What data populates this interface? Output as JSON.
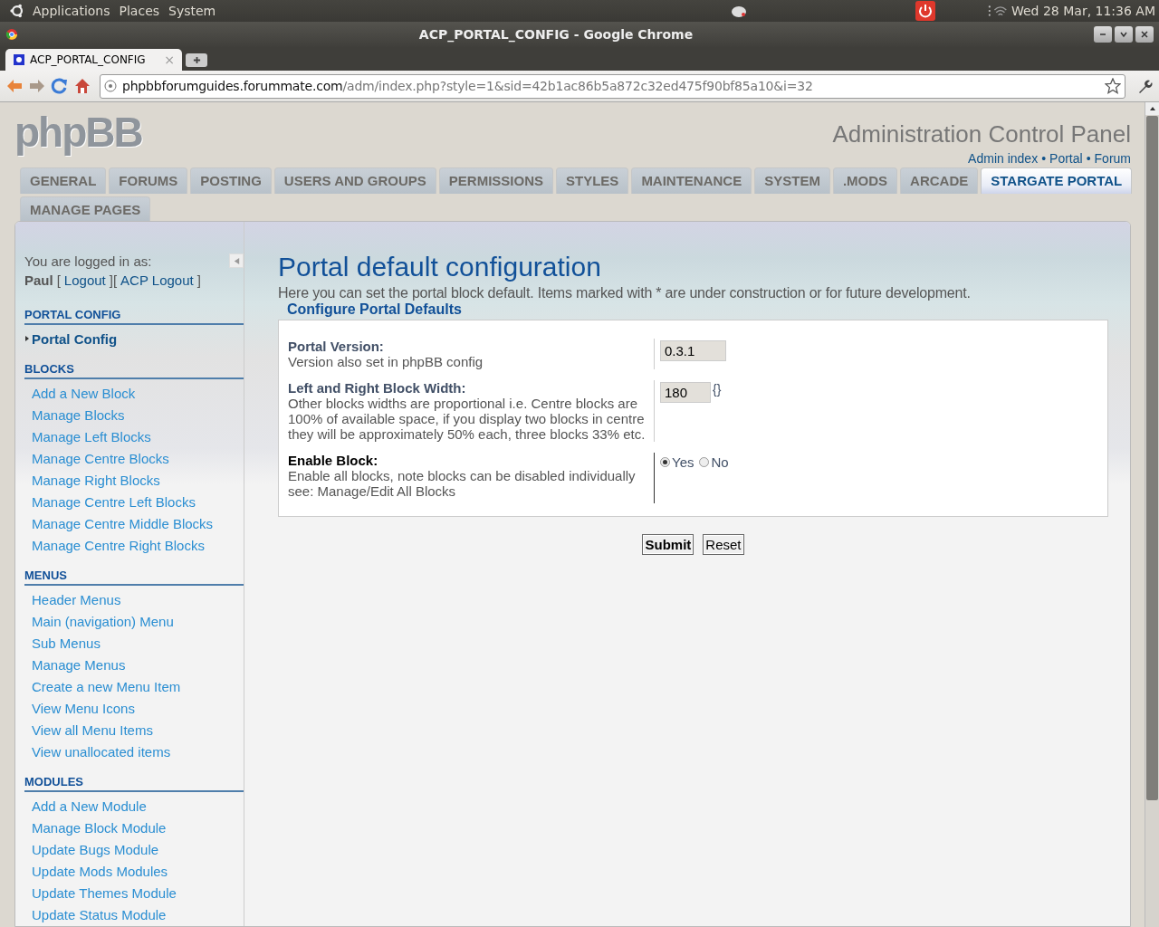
{
  "system_bar": {
    "menus": [
      "Applications",
      "Places",
      "System"
    ],
    "clock": "Wed 28 Mar, 11:36 AM"
  },
  "window": {
    "title": "ACP_PORTAL_CONFIG - Google Chrome"
  },
  "browser_tabs": [
    {
      "label": "ACP_PORTAL_CONFIG",
      "close": "×",
      "selected": true
    }
  ],
  "address_bar": {
    "host": "phpbbforumguides.forummate.com",
    "path": "/adm/index.php?style=1&sid=42b1ac86b5a872c32ed475f90bf85a10&i=32"
  },
  "header": {
    "logo": "phpBB",
    "title": "Administration Control Panel",
    "links": [
      "Admin index",
      "Portal",
      "Forum"
    ],
    "link_separator": "•"
  },
  "nav_tabs": [
    {
      "label": "GENERAL",
      "selected": false
    },
    {
      "label": "FORUMS",
      "selected": false
    },
    {
      "label": "POSTING",
      "selected": false
    },
    {
      "label": "USERS AND GROUPS",
      "selected": false
    },
    {
      "label": "PERMISSIONS",
      "selected": false
    },
    {
      "label": "STYLES",
      "selected": false
    },
    {
      "label": "MAINTENANCE",
      "selected": false
    },
    {
      "label": "SYSTEM",
      "selected": false
    },
    {
      "label": ".MODS",
      "selected": false
    },
    {
      "label": "ARCADE",
      "selected": false
    },
    {
      "label": "STARGATE PORTAL",
      "selected": true
    },
    {
      "label": "MANAGE PAGES",
      "selected": false
    }
  ],
  "sidebar": {
    "logged_in_label": "You are logged in as:",
    "user_line": [
      {
        "kind": "name",
        "text": "Paul"
      },
      {
        "kind": "plain",
        "text": "["
      },
      {
        "kind": "link",
        "text": "Logout"
      },
      {
        "kind": "plain",
        "text": "]["
      },
      {
        "kind": "link",
        "text": "ACP Logout"
      },
      {
        "kind": "plain",
        "text": "]"
      }
    ],
    "sections": [
      {
        "title": "PORTAL CONFIG",
        "items": [
          {
            "label": "Portal Config",
            "selected": true
          }
        ]
      },
      {
        "title": "BLOCKS",
        "items": [
          {
            "label": "Add a New Block",
            "selected": false
          },
          {
            "label": "Manage Blocks",
            "selected": false
          },
          {
            "label": "Manage Left Blocks",
            "selected": false
          },
          {
            "label": "Manage Centre Blocks",
            "selected": false
          },
          {
            "label": "Manage Right Blocks",
            "selected": false
          },
          {
            "label": "Manage Centre Left Blocks",
            "selected": false
          },
          {
            "label": "Manage Centre Middle Blocks",
            "selected": false
          },
          {
            "label": "Manage Centre Right Blocks",
            "selected": false
          }
        ]
      },
      {
        "title": "MENUS",
        "items": [
          {
            "label": "Header Menus",
            "selected": false
          },
          {
            "label": "Main (navigation) Menu",
            "selected": false
          },
          {
            "label": "Sub Menus",
            "selected": false
          },
          {
            "label": "Manage Menus",
            "selected": false
          },
          {
            "label": "Create a new Menu Item",
            "selected": false
          },
          {
            "label": "View Menu Icons",
            "selected": false
          },
          {
            "label": "View all Menu Items",
            "selected": false
          },
          {
            "label": "View unallocated items",
            "selected": false
          }
        ]
      },
      {
        "title": "MODULES",
        "items": [
          {
            "label": "Add a New Module",
            "selected": false
          },
          {
            "label": "Manage Block Module",
            "selected": false
          },
          {
            "label": "Update Bugs Module",
            "selected": false
          },
          {
            "label": "Update Mods Modules",
            "selected": false
          },
          {
            "label": "Update Themes Module",
            "selected": false
          },
          {
            "label": "Update Status Module",
            "selected": false
          }
        ]
      }
    ]
  },
  "main": {
    "title": "Portal default configuration",
    "description": "Here you can set the portal block default. Items marked with * are under construction or for future development.",
    "legend": "Configure Portal Defaults",
    "rows": [
      {
        "kind": "text",
        "label": "Portal Version:",
        "help": "Version also set in phpBB config",
        "value": "0.3.1"
      },
      {
        "kind": "text",
        "label": "Left and Right Block Width:",
        "help": "Other blocks widths are proportional i.e. Centre blocks are 100% of available space, if you display two blocks in centre they will be approximately 50% each, three blocks 33% etc.",
        "value": "180",
        "suffix": "{}"
      },
      {
        "kind": "radio",
        "label": "Enable Block:",
        "help": "Enable all blocks, note blocks can be disabled individually see: Manage/Edit All Blocks",
        "options": [
          {
            "label": "Yes",
            "selected": true
          },
          {
            "label": "No",
            "selected": false
          }
        ]
      }
    ],
    "buttons": [
      "Submit",
      "Reset"
    ]
  }
}
